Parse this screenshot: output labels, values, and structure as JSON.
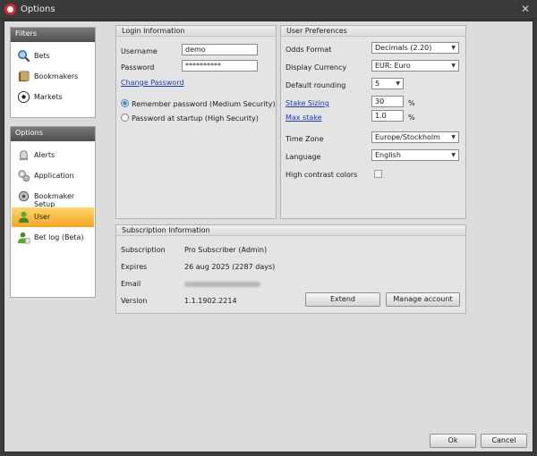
{
  "window": {
    "title": "Options"
  },
  "sidebar": {
    "filters_header": "Filters",
    "filters": [
      {
        "label": "Bets",
        "icon": "magnifier-icon"
      },
      {
        "label": "Bookmakers",
        "icon": "books-icon"
      },
      {
        "label": "Markets",
        "icon": "soccer-ball-icon"
      }
    ],
    "options_header": "Options",
    "options": [
      {
        "label": "Alerts",
        "icon": "alert-icon",
        "active": false
      },
      {
        "label": "Application",
        "icon": "gears-icon",
        "active": false
      },
      {
        "label": "Bookmaker Setup",
        "icon": "setup-icon",
        "active": false
      },
      {
        "label": "User",
        "icon": "user-icon",
        "active": true
      },
      {
        "label": "Bet log (Beta)",
        "icon": "log-icon",
        "active": false
      }
    ]
  },
  "login": {
    "title": "Login Information",
    "username_label": "Username",
    "username_value": "demo",
    "password_label": "Password",
    "password_value": "**********",
    "change_password": "Change Password",
    "remember_option": "Remember password (Medium Security)",
    "startup_option": "Password at startup (High Security)",
    "selected_option": "remember"
  },
  "prefs": {
    "title": "User Preferences",
    "odds_format_label": "Odds Format",
    "odds_format_value": "Decimals (2.20)",
    "display_currency_label": "Display Currency",
    "display_currency_value": "EUR: Euro",
    "default_rounding_label": "Default rounding",
    "default_rounding_value": "5",
    "stake_sizing_label": "Stake Sizing",
    "stake_sizing_value": "30",
    "stake_sizing_unit": "%",
    "max_stake_label": "Max stake",
    "max_stake_value": "1.0",
    "max_stake_unit": "%",
    "time_zone_label": "Time Zone",
    "time_zone_value": "Europe/Stockholm",
    "language_label": "Language",
    "language_value": "English",
    "high_contrast_label": "High contrast colors",
    "high_contrast_checked": false
  },
  "subscription": {
    "title": "Subscription Information",
    "subscription_label": "Subscription",
    "subscription_value": "Pro Subscriber (Admin)",
    "expires_label": "Expires",
    "expires_value": "26 aug 2025 (2287 days)",
    "email_label": "Email",
    "version_label": "Version",
    "version_value": "1.1.1902.2214",
    "extend_button": "Extend",
    "manage_button": "Manage account"
  },
  "footer": {
    "ok_button": "Ok",
    "cancel_button": "Cancel"
  },
  "colors": {
    "active_item": "#f5a623",
    "link": "#1a3dbc",
    "brand": "#d8262b"
  }
}
